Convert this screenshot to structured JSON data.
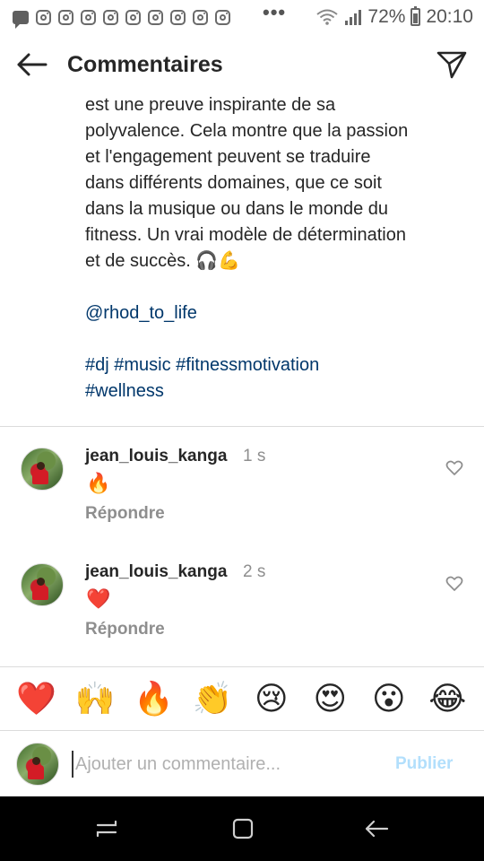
{
  "status_bar": {
    "battery": "72%",
    "time": "20:10",
    "dots": "•••"
  },
  "header": {
    "title": "Commentaires"
  },
  "caption": {
    "lines": [
      "est une preuve inspirante de sa",
      "polyvalence. Cela montre que la passion",
      "et l'engagement peuvent se traduire",
      "dans différents domaines, que ce soit",
      "dans la musique ou dans le monde du",
      "fitness. Un vrai modèle de détermination",
      "et de succès. 🎧💪"
    ],
    "mention": "@rhod_to_life",
    "hashtags_line1": "#dj #music #fitnessmotivation",
    "hashtags_line2": "#wellness"
  },
  "comments": [
    {
      "username": "jean_louis_kanga",
      "time": "1 s",
      "text": "🔥",
      "reply_label": "Répondre"
    },
    {
      "username": "jean_louis_kanga",
      "time": "2 s",
      "text": "❤️",
      "reply_label": "Répondre"
    }
  ],
  "emoji_bar": [
    "❤️",
    "🙌",
    "🔥",
    "👏",
    "😢",
    "😍",
    "😮",
    "😂"
  ],
  "input": {
    "placeholder": "Ajouter un commentaire...",
    "value": "",
    "publish_label": "Publier"
  },
  "colors": {
    "link": "#00376b",
    "muted": "#8e8e8e",
    "publish_disabled": "#b2dffc"
  }
}
